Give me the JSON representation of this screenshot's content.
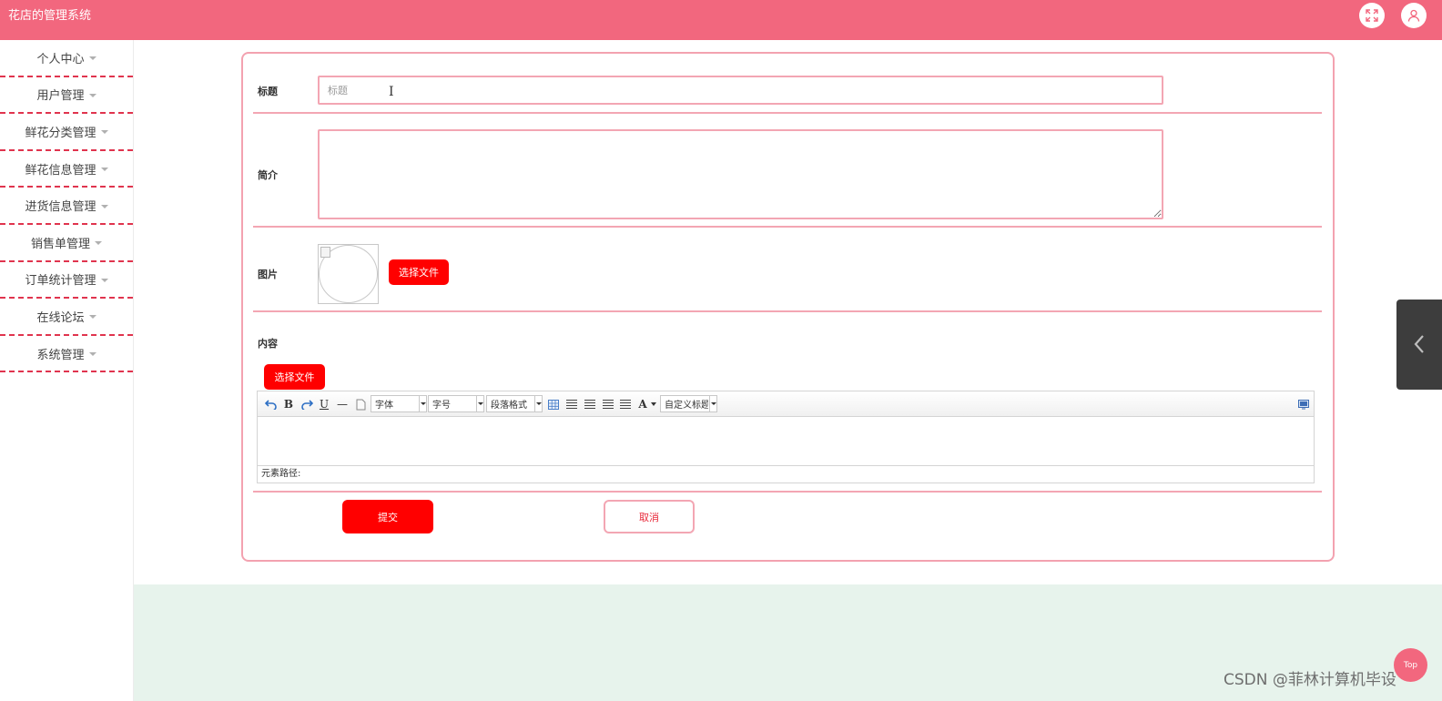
{
  "header": {
    "app_title": "花店的管理系统",
    "fullscreen_icon": "expand-icon",
    "user_icon": "user-icon"
  },
  "sidebar": {
    "items": [
      {
        "label": "个人中心"
      },
      {
        "label": "用户管理"
      },
      {
        "label": "鲜花分类管理"
      },
      {
        "label": "鲜花信息管理"
      },
      {
        "label": "进货信息管理"
      },
      {
        "label": "销售单管理"
      },
      {
        "label": "订单统计管理"
      },
      {
        "label": "在线论坛"
      },
      {
        "label": "系统管理"
      }
    ]
  },
  "form": {
    "title_label": "标题",
    "title_placeholder": "标题",
    "title_value": "",
    "intro_label": "简介",
    "intro_value": "",
    "image_label": "图片",
    "image_button": "选择文件",
    "content_label": "内容",
    "content_button": "选择文件",
    "submit_label": "提交",
    "cancel_label": "取消"
  },
  "editor": {
    "bold": "B",
    "underline": "U",
    "hr": "—",
    "font_family": "字体",
    "font_size": "字号",
    "paragraph": "段落格式",
    "font_color": "A",
    "custom_title": "自定义标题",
    "status_path": "元素路径:"
  },
  "misc": {
    "top_button": "Top",
    "watermark": "CSDN @菲林计算机毕设"
  },
  "colors": {
    "brand": "#f2677e",
    "button": "#ff0000",
    "border": "#f3a6b3",
    "footer_bg": "#e7f3ec"
  }
}
